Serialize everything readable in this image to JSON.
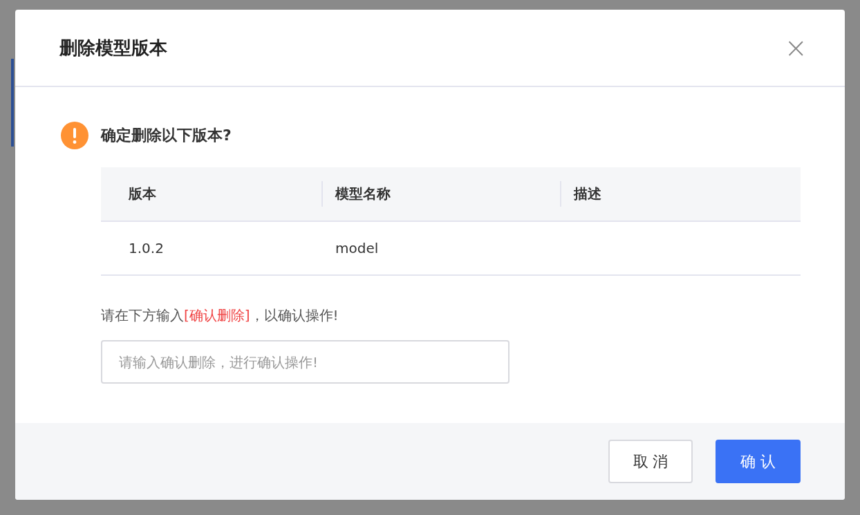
{
  "dialog": {
    "title": "删除模型版本",
    "close_label": "×",
    "question": "确定删除以下版本?",
    "table": {
      "columns": [
        "版本",
        "模型名称",
        "描述"
      ],
      "rows": [
        [
          "1.0.2",
          "model",
          ""
        ]
      ]
    },
    "instruction": {
      "before": "请在下方输入",
      "highlight": "[确认删除]",
      "after": "，以确认操作!"
    },
    "input": {
      "placeholder": "请输入确认删除，进行确认操作!"
    },
    "buttons": [
      {
        "label": "取 消",
        "kind": "secondary"
      },
      {
        "label": "确 认",
        "kind": "primary"
      }
    ]
  }
}
